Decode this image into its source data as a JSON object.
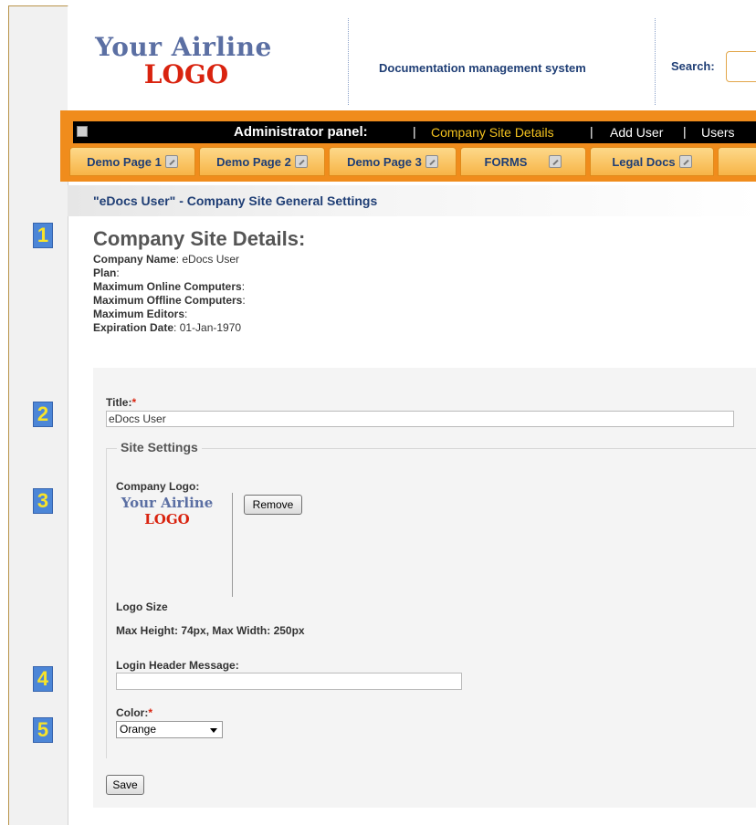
{
  "header": {
    "logo_line1": "Your Airline",
    "logo_line2": "LOGO",
    "system_title": "Documentation management system",
    "search_label": "Search:"
  },
  "admin_bar": {
    "title": "Administrator panel:",
    "links": [
      "Company Site Details",
      "Add User",
      "Users"
    ],
    "active_link": "Company Site Details"
  },
  "tabs": [
    "Demo Page 1",
    "Demo Page 2",
    "Demo Page 3",
    "FORMS",
    "Legal Docs"
  ],
  "section_title": "\"eDocs User\" - Company Site General Settings",
  "markers": [
    "1",
    "2",
    "3",
    "4",
    "5"
  ],
  "details": {
    "heading": "Company Site Details:",
    "company_name_label": "Company Name",
    "company_name_value": ": eDocs User",
    "plan_label": "Plan",
    "plan_value": ":",
    "max_online_label": "Maximum Online Computers",
    "max_online_value": ":",
    "max_offline_label": "Maximum Offline Computers",
    "max_offline_value": ":",
    "max_editors_label": "Maximum Editors",
    "max_editors_value": ":",
    "expiration_label": "Expiration Date",
    "expiration_value": ": 01-Jan-1970"
  },
  "form": {
    "title_label": "Title:",
    "required_mark": "*",
    "title_value": "eDocs User",
    "site_settings_legend": "Site Settings",
    "company_logo_label": "Company Logo:",
    "logo_small_line1": "Your Airline",
    "logo_small_line2": "LOGO",
    "remove_button": "Remove",
    "logo_size_label": "Logo Size",
    "logo_size_value": "Max Height: 74px, Max Width: 250px",
    "login_header_label": "Login Header Message:",
    "login_header_value": "",
    "color_label": "Color:",
    "color_value": "Orange",
    "save_button": "Save"
  }
}
